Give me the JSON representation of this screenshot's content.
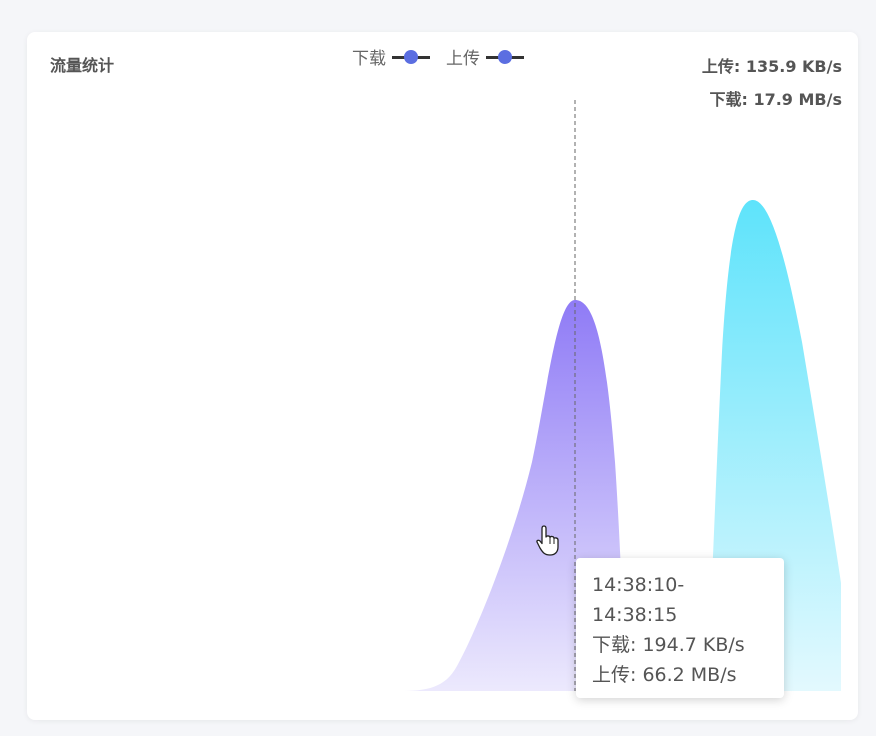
{
  "card": {
    "title": "流量统计"
  },
  "legend": [
    {
      "label": "下载",
      "color": "#5b6ee1"
    },
    {
      "label": "上传",
      "color": "#5b6ee1"
    }
  ],
  "stats": {
    "upload": "上传: 135.9 KB/s",
    "download": "下载: 17.9 MB/s"
  },
  "tooltip": {
    "time": "14:38:10-14:38:15",
    "download": "下载: 194.7 KB/s",
    "upload": "上传: 66.2 MB/s"
  },
  "chart_data": {
    "type": "area",
    "title": "流量统计",
    "xlabel": "",
    "ylabel": "",
    "grid": false,
    "axes_visible": false,
    "legend_position": "top-center",
    "series": [
      {
        "name": "下载",
        "color_top": "#8f7bf6",
        "color_bottom": "#ece9fd",
        "peak": 194.7
      },
      {
        "name": "上传",
        "color_top": "#5ee3fb",
        "color_bottom": "#e3f9fe",
        "peak": 242
      }
    ]
  }
}
